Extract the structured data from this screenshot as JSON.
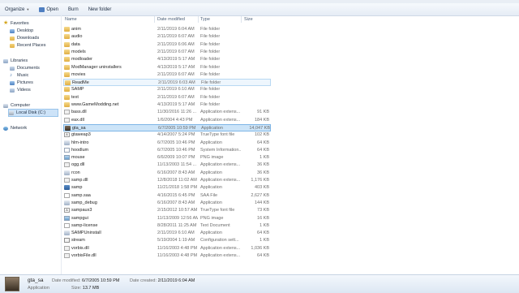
{
  "toolbar": {
    "organize": "Organize",
    "open": "Open",
    "burn": "Burn",
    "new_folder": "New folder"
  },
  "nav": {
    "items": [
      {
        "label": "Favorites",
        "icon": "star-icon"
      },
      {
        "label": "Desktop",
        "icon": "desktop-icon"
      },
      {
        "label": "Downloads",
        "icon": "downloads-icon"
      },
      {
        "label": "Recent Places",
        "icon": "recent-places-icon"
      },
      {
        "label": "Libraries",
        "icon": "libraries-icon"
      },
      {
        "label": "Documents",
        "icon": "documents-icon"
      },
      {
        "label": "Music",
        "icon": "music-icon"
      },
      {
        "label": "Pictures",
        "icon": "pictures-icon"
      },
      {
        "label": "Videos",
        "icon": "videos-icon"
      },
      {
        "label": "Computer",
        "icon": "computer-icon"
      },
      {
        "label": "Local Disk (C:)",
        "icon": "disk-icon"
      },
      {
        "label": "Network",
        "icon": "network-icon"
      }
    ]
  },
  "columns": {
    "name": "Name",
    "date": "Date modified",
    "type": "Type",
    "size": "Size"
  },
  "files": [
    {
      "name": "anim",
      "date": "2/11/2019 6:04 AM",
      "type": "File folder",
      "size": "",
      "icon": "folder"
    },
    {
      "name": "audio",
      "date": "2/11/2019 6:07 AM",
      "type": "File folder",
      "size": "",
      "icon": "folder"
    },
    {
      "name": "data",
      "date": "2/11/2019 6:06 AM",
      "type": "File folder",
      "size": "",
      "icon": "folder"
    },
    {
      "name": "models",
      "date": "2/11/2019 6:07 AM",
      "type": "File folder",
      "size": "",
      "icon": "folder"
    },
    {
      "name": "modloader",
      "date": "4/13/2019 5:17 AM",
      "type": "File folder",
      "size": "",
      "icon": "folder"
    },
    {
      "name": "ModManager uninstallers",
      "date": "4/13/2019 5:17 AM",
      "type": "File folder",
      "size": "",
      "icon": "folder"
    },
    {
      "name": "movies",
      "date": "2/11/2019 6:07 AM",
      "type": "File folder",
      "size": "",
      "icon": "folder"
    },
    {
      "name": "ReadMe",
      "date": "2/11/2019 6:03 AM",
      "type": "File folder",
      "size": "",
      "icon": "folder"
    },
    {
      "name": "SAMP",
      "date": "2/11/2019 6:10 AM",
      "type": "File folder",
      "size": "",
      "icon": "folder"
    },
    {
      "name": "text",
      "date": "2/11/2019 6:07 AM",
      "type": "File folder",
      "size": "",
      "icon": "folder"
    },
    {
      "name": "www.GameModding.net",
      "date": "4/13/2019 5:17 AM",
      "type": "File folder",
      "size": "",
      "icon": "folder"
    },
    {
      "name": "bass.dll",
      "date": "11/30/2016 11:26 ...",
      "type": "Application extens...",
      "size": "91 KB",
      "icon": "dll"
    },
    {
      "name": "eax.dll",
      "date": "1/6/2004 4:43 PM",
      "type": "Application extens...",
      "size": "184 KB",
      "icon": "dll"
    },
    {
      "name": "gta_sa",
      "date": "6/7/2005 10:59 PM",
      "type": "Application",
      "size": "14,047 KB",
      "icon": "game"
    },
    {
      "name": "gtaweap3",
      "date": "4/14/2007 5:24 PM",
      "type": "TrueType font file",
      "size": "102 KB",
      "icon": "font"
    },
    {
      "name": "hlm-intro",
      "date": "6/7/2005 10:46 PM",
      "type": "Application",
      "size": "64 KB",
      "icon": "exe"
    },
    {
      "name": "hoodlum",
      "date": "6/7/2005 10:46 PM",
      "type": "System Information...",
      "size": "64 KB",
      "icon": "ini"
    },
    {
      "name": "mouse",
      "date": "6/6/2009 10:07 PM",
      "type": "PNG image",
      "size": "1 KB",
      "icon": "png"
    },
    {
      "name": "ogg.dll",
      "date": "11/13/2003 11:54 ...",
      "type": "Application extens...",
      "size": "36 KB",
      "icon": "dll"
    },
    {
      "name": "rcon",
      "date": "6/16/2007 8:43 AM",
      "type": "Application",
      "size": "36 KB",
      "icon": "exe"
    },
    {
      "name": "samp.dll",
      "date": "12/8/2018 11:02 AM",
      "type": "Application extens...",
      "size": "1,176 KB",
      "icon": "dll"
    },
    {
      "name": "samp",
      "date": "11/21/2018 1:58 PM",
      "type": "Application",
      "size": "403 KB",
      "icon": "samp"
    },
    {
      "name": "samp.saa",
      "date": "4/16/2015 6:45 PM",
      "type": "SAA File",
      "size": "2,627 KB",
      "icon": "file"
    },
    {
      "name": "samp_debug",
      "date": "6/16/2007 8:43 AM",
      "type": "Application",
      "size": "144 KB",
      "icon": "exe"
    },
    {
      "name": "sampaux3",
      "date": "2/15/2012 10:57 AM",
      "type": "TrueType font file",
      "size": "73 KB",
      "icon": "font"
    },
    {
      "name": "sampgui",
      "date": "11/13/2009 12:56 AM",
      "type": "PNG image",
      "size": "16 KB",
      "icon": "png"
    },
    {
      "name": "samp-license",
      "date": "8/28/2011 11:25 AM",
      "type": "Text Document",
      "size": "1 KB",
      "icon": "txt"
    },
    {
      "name": "SAMPUninstall",
      "date": "2/11/2019 6:10 AM",
      "type": "Application",
      "size": "64 KB",
      "icon": "exe"
    },
    {
      "name": "stream",
      "date": "5/19/2004 1:19 AM",
      "type": "Configuration sett...",
      "size": "1 KB",
      "icon": "cfg"
    },
    {
      "name": "vorbis.dll",
      "date": "11/16/2003 4:48 PM",
      "type": "Application extens...",
      "size": "1,036 KB",
      "icon": "dll"
    },
    {
      "name": "vorbisFile.dll",
      "date": "11/16/2003 4:48 PM",
      "type": "Application extens...",
      "size": "64 KB",
      "icon": "dll"
    }
  ],
  "selected_index": 13,
  "hover_index": 7,
  "details": {
    "name": "gta_sa",
    "type": "Application",
    "date_modified_label": "Date modified:",
    "date_modified": "6/7/2005 10:59 PM",
    "date_created_label": "Date created:",
    "date_created": "2/11/2019 6:04 AM",
    "size_label": "Size:",
    "size": "13.7 MB"
  }
}
